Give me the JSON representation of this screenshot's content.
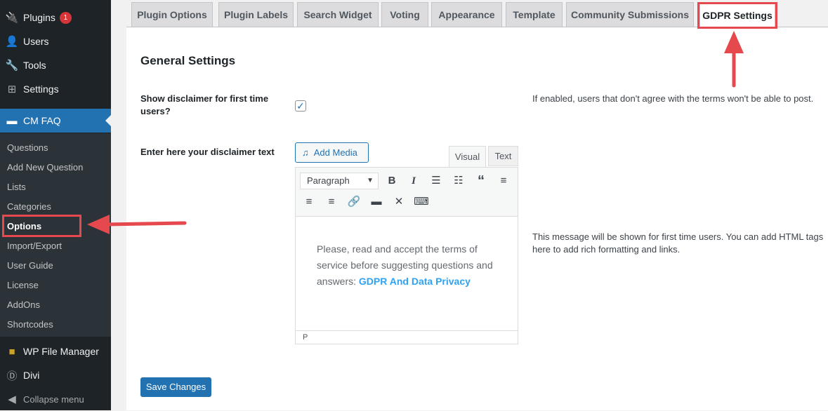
{
  "sidebar": {
    "plugins": "Plugins",
    "plugins_badge": "1",
    "users": "Users",
    "tools": "Tools",
    "settings": "Settings",
    "cmfaq": "CM FAQ",
    "submenu": [
      "Questions",
      "Add New Question",
      "Lists",
      "Categories",
      "Options",
      "Import/Export",
      "User Guide",
      "License",
      "AddOns",
      "Shortcodes"
    ],
    "file_manager": "WP File Manager",
    "divi": "Divi",
    "collapse": "Collapse menu"
  },
  "tabs": [
    "Plugin Options",
    "Plugin Labels",
    "Search Widget",
    "Voting",
    "Appearance",
    "Template",
    "Community Submissions",
    "GDPR Settings"
  ],
  "active_tab": "GDPR Settings",
  "section_title": "General Settings",
  "disclaimer": {
    "label": "Show disclaimer for first time users?",
    "checked": true,
    "description": "If enabled, users that don't agree with the terms won't be able to post."
  },
  "text": {
    "label": "Enter here your disclaimer text",
    "description": "This message will be shown for first time users. You can add HTML tags here to add rich formatting and links."
  },
  "editor": {
    "add_media": "Add Media",
    "tab_visual": "Visual",
    "tab_text": "Text",
    "format": "Paragraph",
    "content": "Please, read and accept the terms of service before suggesting questions and answers: ",
    "link": "GDPR And Data Privacy",
    "status": "P"
  },
  "save": "Save Changes",
  "colors": {
    "accent": "#2271b1",
    "annotation": "#e5484d"
  }
}
